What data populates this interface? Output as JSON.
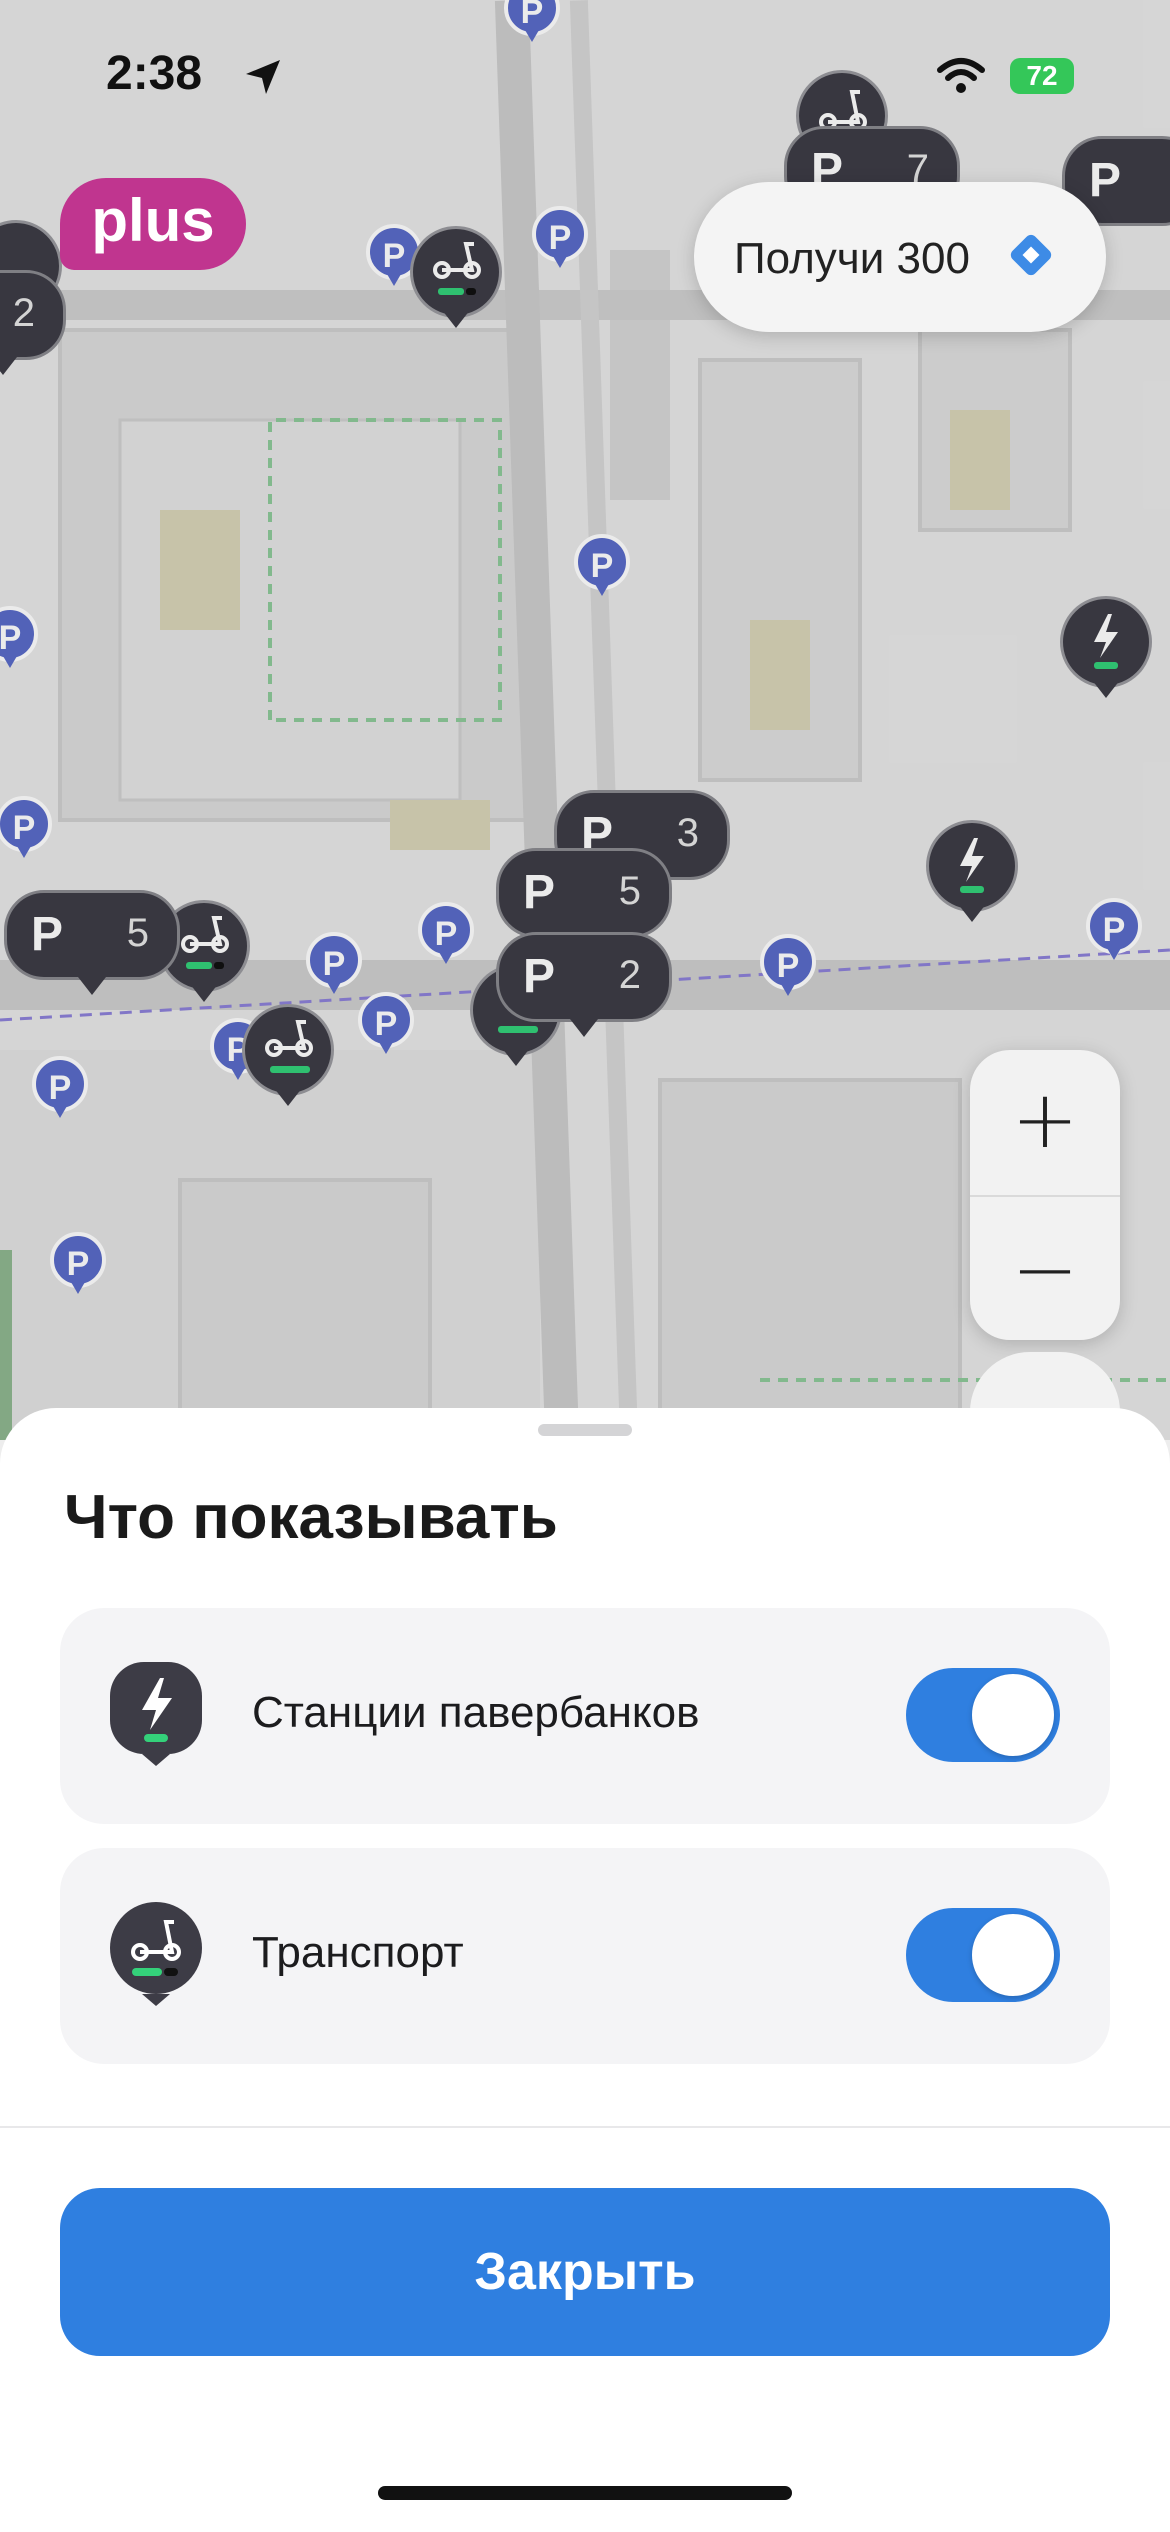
{
  "status_bar": {
    "time": "2:38",
    "battery": "72"
  },
  "map": {
    "plus_badge": "plus",
    "promo_label": "Получи 300",
    "parking_letter": "P",
    "parking_clusters": [
      {
        "count": "7"
      },
      {
        "count": "2"
      },
      {
        "count": "3"
      },
      {
        "count": "5"
      },
      {
        "count": "5"
      },
      {
        "count": "2"
      }
    ],
    "zoom_in": "+",
    "zoom_out": "−"
  },
  "sheet": {
    "title": "Что показывать",
    "options": [
      {
        "label": "Станции павербанков",
        "enabled": true,
        "icon": "powerbank-station-icon"
      },
      {
        "label": "Транспорт",
        "enabled": true,
        "icon": "scooter-icon"
      }
    ],
    "close_label": "Закрыть"
  },
  "colors": {
    "accent": "#2f7fe0",
    "marker": "#3d3c46",
    "parking": "#5a6bc8",
    "plus": "#c0358f"
  }
}
